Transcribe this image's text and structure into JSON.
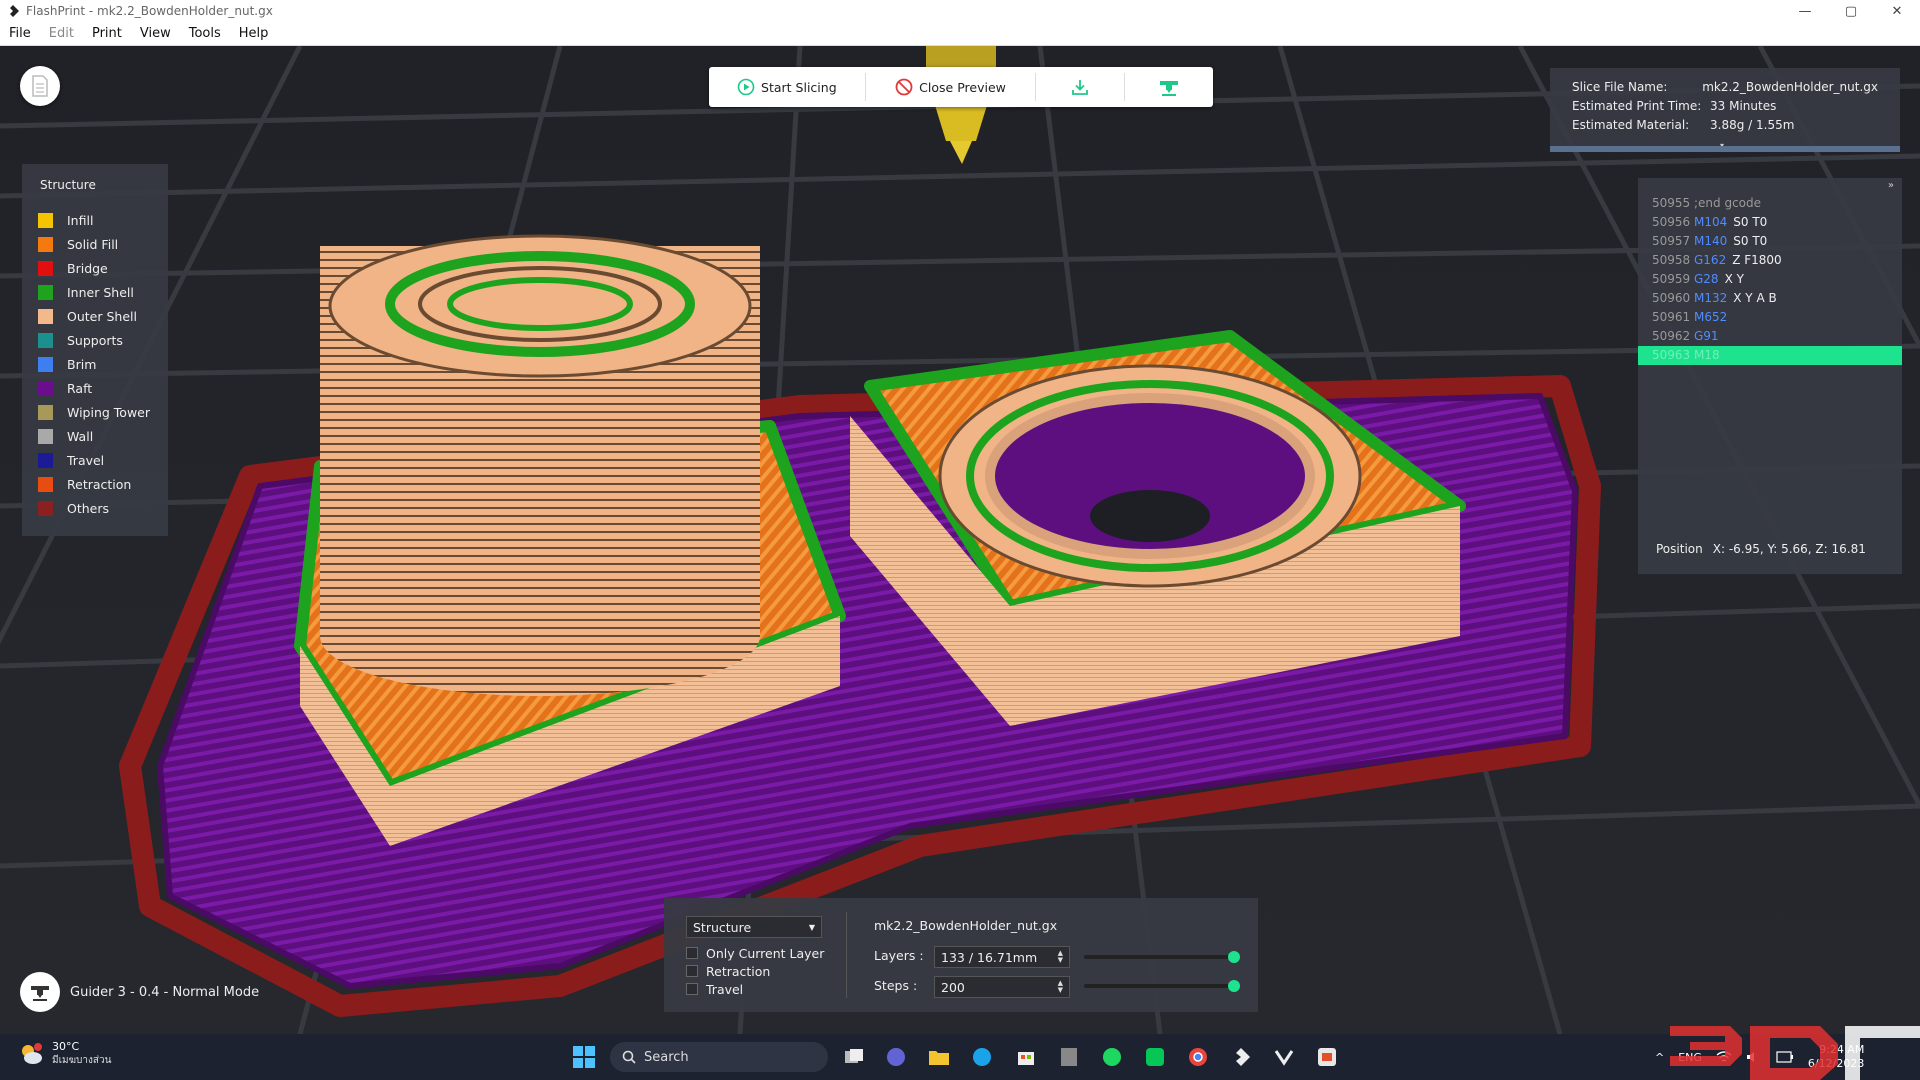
{
  "window": {
    "title": "FlashPrint - mk2.2_BowdenHolder_nut.gx",
    "minimize": "—",
    "maximize": "▢",
    "close": "✕"
  },
  "menu": {
    "items": [
      "File",
      "Edit",
      "Print",
      "View",
      "Tools",
      "Help"
    ]
  },
  "toolbar": {
    "start_slicing": "Start Slicing",
    "close_preview": "Close Preview"
  },
  "legend": {
    "title": "Structure",
    "items": [
      {
        "label": "Infill",
        "color": "#f5c400"
      },
      {
        "label": "Solid Fill",
        "color": "#f47a10"
      },
      {
        "label": "Bridge",
        "color": "#e01010"
      },
      {
        "label": "Inner Shell",
        "color": "#1ea31e"
      },
      {
        "label": "Outer Shell",
        "color": "#f3b98a"
      },
      {
        "label": "Supports",
        "color": "#1c8f8f"
      },
      {
        "label": "Brim",
        "color": "#3f7ef0"
      },
      {
        "label": "Raft",
        "color": "#6a0e8e"
      },
      {
        "label": "Wiping Tower",
        "color": "#a8985a"
      },
      {
        "label": "Wall",
        "color": "#a9a9a9"
      },
      {
        "label": "Travel",
        "color": "#1b1b98"
      },
      {
        "label": "Retraction",
        "color": "#e74c10"
      },
      {
        "label": "Others",
        "color": "#8a2020"
      }
    ]
  },
  "info": {
    "slice_file_name_label": "Slice File Name:",
    "slice_file_name": "mk2.2_BowdenHolder_nut.gx",
    "print_time_label": "Estimated Print Time:",
    "print_time": "33 Minutes",
    "material_label": "Estimated Material:",
    "material": "3.88g / 1.55m",
    "caret": "▾"
  },
  "gcode": {
    "collapse": "»",
    "lines": [
      {
        "num": "50955",
        "cmd": "",
        "args": "",
        "comment": ";end gcode"
      },
      {
        "num": "50956",
        "cmd": "M104",
        "args": "S0 T0",
        "comment": ""
      },
      {
        "num": "50957",
        "cmd": "M140",
        "args": "S0 T0",
        "comment": ""
      },
      {
        "num": "50958",
        "cmd": "G162",
        "args": "Z F1800",
        "comment": ""
      },
      {
        "num": "50959",
        "cmd": "G28",
        "args": "X Y",
        "comment": ""
      },
      {
        "num": "50960",
        "cmd": "M132",
        "args": "X Y A B",
        "comment": ""
      },
      {
        "num": "50961",
        "cmd": "M652",
        "args": "",
        "comment": ""
      },
      {
        "num": "50962",
        "cmd": "G91",
        "args": "",
        "comment": ""
      },
      {
        "num": "50963",
        "cmd": "M18",
        "args": "",
        "comment": ""
      }
    ],
    "position_label": "Position",
    "position_value": "X: -6.95, Y: 5.66, Z: 16.81"
  },
  "controls": {
    "view_mode": "Structure",
    "only_current_layer": "Only Current Layer",
    "retraction": "Retraction",
    "travel": "Travel",
    "filename": "mk2.2_BowdenHolder_nut.gx",
    "layers_label": "Layers :",
    "layers_value": "133 / 16.71mm",
    "steps_label": "Steps :",
    "steps_value": "200",
    "layers_slider_fraction": 1.0,
    "steps_slider_fraction": 1.0
  },
  "printer": {
    "label": "Guider 3 - 0.4 - Normal Mode"
  },
  "taskbar": {
    "temp": "30°C",
    "condition": "มีเมฆบางส่วน",
    "search": "Search",
    "language": "ENG",
    "time": "9:24 AM",
    "date": "6/12/2023"
  },
  "colors": {
    "accent": "#1de38f",
    "link": "#4f8cff"
  }
}
